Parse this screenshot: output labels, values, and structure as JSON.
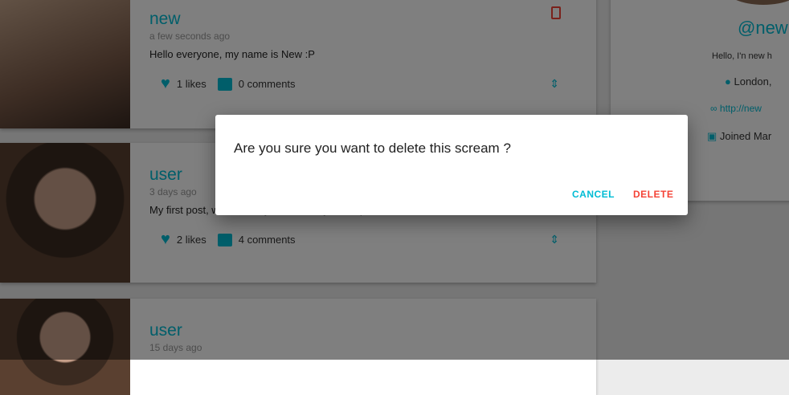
{
  "posts": [
    {
      "handle": "new",
      "time": "a few seconds ago",
      "body": "Hello everyone, my name is New :P",
      "likes": "1 likes",
      "comments": "0 comments"
    },
    {
      "handle": "user",
      "time": "3 days ago",
      "body": "My first post, was an easy name, I'll try to keep it short from now on",
      "likes": "2 likes",
      "comments": "4 comments"
    },
    {
      "handle": "user",
      "time": "15 days ago"
    }
  ],
  "profile": {
    "handle": "@new",
    "bio": "Hello, I'n new h",
    "location": "London,",
    "website": "http://new",
    "joined": "Joined Mar"
  },
  "dialog": {
    "question": "Are you sure you want to delete this scream ?",
    "cancel": "CANCEL",
    "delete": "DELETE"
  },
  "colors": {
    "accent": "#00bcd4",
    "danger": "#f44336"
  }
}
